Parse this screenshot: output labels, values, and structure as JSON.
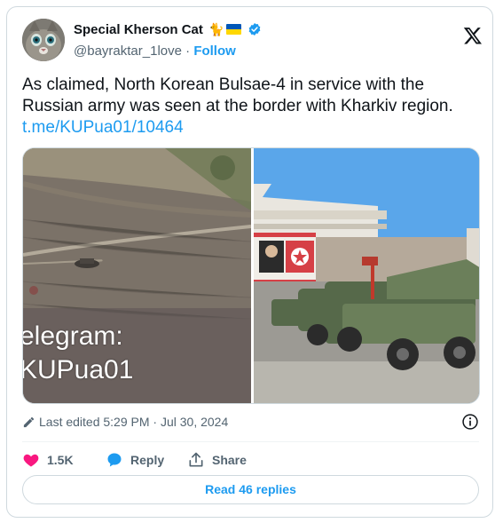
{
  "author": {
    "name": "Special Kherson Cat",
    "name_emoji": "🐈",
    "handle": "@bayraktar_1love",
    "separator": "·",
    "follow_label": "Follow"
  },
  "tweet": {
    "text": "As claimed, North Korean Bulsae-4 in service with the Russian army was seen at the border with Kharkiv region.",
    "link": "t.me/KUPua01/10464"
  },
  "media": {
    "watermark_line1": "elegram:",
    "watermark_line2": "KUPua01"
  },
  "meta": {
    "edited": "Last edited 5:29 PM · Jul 30, 2024"
  },
  "actions": {
    "likes": "1.5K",
    "reply_label": "Reply",
    "share_label": "Share"
  },
  "replies_button": "Read 46 replies",
  "colors": {
    "accent": "#1d9bf0",
    "like": "#f91880",
    "muted": "#536471",
    "border": "#cfd9de"
  }
}
